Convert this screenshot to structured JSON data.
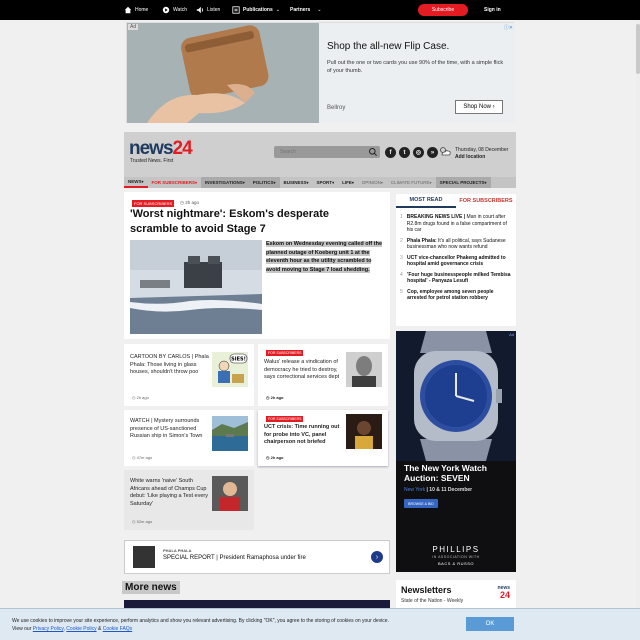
{
  "topbar": {
    "home": "Home",
    "watch": "Watch",
    "listen": "Listen",
    "publications": "Publications",
    "partners": "Partners",
    "subscribe": "Subscribe",
    "signin": "Sign in"
  },
  "ad_top": {
    "badge": "Ad",
    "headline": "Shop the all-new Flip Case.",
    "body": "Pull out the one or two cards you use 90% of the time, with a simple flick of your thumb.",
    "brand": "Bellroy",
    "cta": "Shop Now"
  },
  "header": {
    "logo_main": "news",
    "logo_num": "24",
    "tagline": "Trusted News. First",
    "search_placeholder": "Search",
    "date": "Thursday, 08 December",
    "add_location": "Add location"
  },
  "nav": [
    {
      "label": "NEWS",
      "style": "active"
    },
    {
      "label": "FOR SUBSCRIBERS",
      "style": "subs"
    },
    {
      "label": "INVESTIGATIONS",
      "style": "box"
    },
    {
      "label": "POLITICS",
      "style": "box"
    },
    {
      "label": "BUSINESS",
      "style": ""
    },
    {
      "label": "SPORT",
      "style": ""
    },
    {
      "label": "LIFE",
      "style": ""
    },
    {
      "label": "OPINION",
      "style": "faded"
    },
    {
      "label": "CLIMATE FUTURE",
      "style": "faded"
    },
    {
      "label": "SPECIAL PROJECTS",
      "style": "box"
    }
  ],
  "lead": {
    "tag": "FOR SUBSCRIBERS",
    "time": "2h ago",
    "title": "'Worst nightmare': Eskom's desperate scramble to avoid Stage 7",
    "summary": "Eskom on Wednesday evening called off the planned outage of Koeberg unit 1 at the eleventh hour as the utility scrambled to avoid moving to Stage 7 load shedding."
  },
  "stories": {
    "s1": {
      "title": "CARTOON BY CARLOS | Phala Phala: Those living in glass houses, shouldn't throw poo",
      "time": "2h ago",
      "thumb_label": "SIES!"
    },
    "s2": {
      "tag": "FOR SUBSCRIBERS",
      "title": "Walus' release a vindication of democracy he tried to destroy, says correctional services dept",
      "time": "2h ago"
    },
    "s3": {
      "title": "WATCH | Mystery surrounds presence of US-sanctioned Russian ship in Simon's Town",
      "time": "47m ago"
    },
    "s4": {
      "tag": "FOR SUBSCRIBERS",
      "title": "UCT crisis: Time running out for probe into VC, panel chairperson not briefed",
      "time": "2h ago"
    },
    "s5": {
      "title": "White warns 'naive' South Africans ahead of Champs Cup debut: 'Like playing a Test every Saturday'",
      "time": "52m ago"
    }
  },
  "special": {
    "label": "PHALA PHALA",
    "title": "SPECIAL REPORT | President Ramaphosa under fire"
  },
  "more_news": "More news",
  "most_read": {
    "tab1": "MOST READ",
    "tab2": "FOR SUBSCRIBERS",
    "items": [
      {
        "n": "1",
        "bold": "BREAKING NEWS LIVE |",
        "rest": " Man in court after R2.8m drugs found in a false compartment of his car"
      },
      {
        "n": "2",
        "bold": "Phala Phala:",
        "rest": " It's all political, says Sudanese businessman who now wants refund"
      },
      {
        "n": "3",
        "bold": "UCT vice-chancellor Phakeng admitted to hospital amid governance crisis",
        "rest": ""
      },
      {
        "n": "4",
        "bold": "'Four huge businesspeople milked Tembisa hospital' - Panyaza Lesufi",
        "rest": ""
      },
      {
        "n": "5",
        "bold": "Cop, employee among seven people arrested for petrol station robbery",
        "rest": ""
      }
    ]
  },
  "watch_ad": {
    "badge": "Ad",
    "headline": "The New York Watch Auction: SEVEN",
    "place": "New York",
    "dates": " | 10 & 11 December",
    "button": "BROWSE & BID",
    "logo": "PHILLIPS",
    "sub": "IN ASSOCIATION WITH",
    "brand2": "BACS & RUSSO"
  },
  "newsletters": {
    "title": "Newsletters",
    "sub": "State of the Nation - Weekly",
    "logo_main": "news",
    "logo_num": "24"
  },
  "cookie": {
    "text": "We use cookies to improve your site experience, perform analytics and show you relevant advertising. By clicking \"OK\", you agree to the storing of cookies on your device. View our ",
    "privacy": "Privacy Policy",
    "sep1": ", ",
    "cookie_policy": "Cookie Policy",
    "sep2": " & ",
    "faqs": "Cookie FAQs",
    "ok": "OK"
  },
  "colors": {
    "brand_red": "#e31c23",
    "brand_navy": "#1e3a5f",
    "cookie_button": "#5b9bd5"
  }
}
